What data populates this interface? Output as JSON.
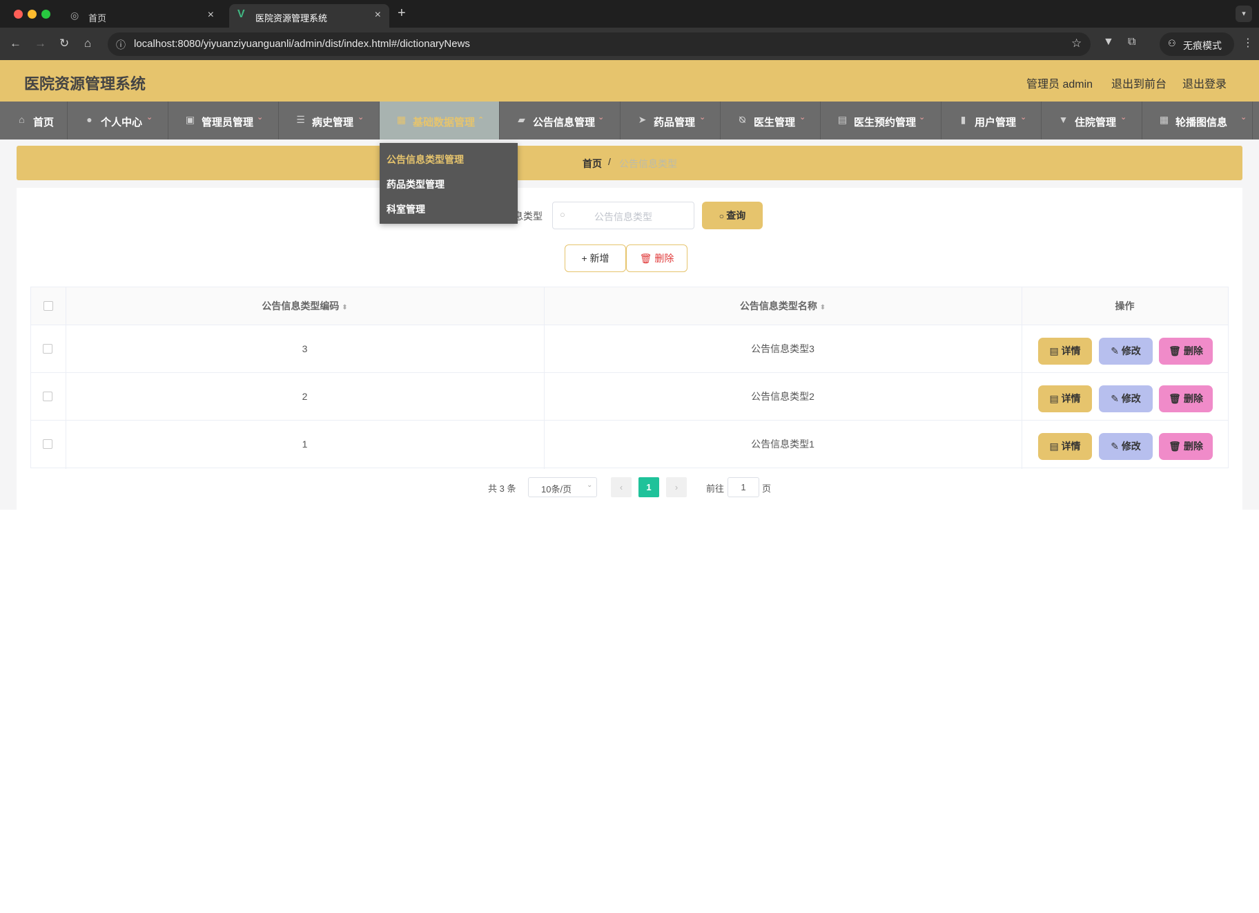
{
  "browser": {
    "tabs": [
      {
        "title": "首页"
      },
      {
        "title": "医院资源管理系统"
      }
    ],
    "url": "localhost:8080/yiyuanziyuanguanli/admin/dist/index.html#/dictionaryNews",
    "incognito_label": "无痕模式"
  },
  "header": {
    "title": "医院资源管理系统",
    "user": "管理员 admin",
    "back_frontend": "退出到前台",
    "logout": "退出登录"
  },
  "menu": [
    {
      "label": "首页",
      "icon": "home-icon"
    },
    {
      "label": "个人中心",
      "icon": "user-icon"
    },
    {
      "label": "管理员管理",
      "icon": "chart-icon"
    },
    {
      "label": "病史管理",
      "icon": "list-icon"
    },
    {
      "label": "基础数据管理",
      "icon": "grid-icon",
      "active": true
    },
    {
      "label": "公告信息管理",
      "icon": "ticket-icon"
    },
    {
      "label": "药品管理",
      "icon": "send-icon"
    },
    {
      "label": "医生管理",
      "icon": "bell-off-icon"
    },
    {
      "label": "医生预约管理",
      "icon": "briefcase-icon"
    },
    {
      "label": "用户管理",
      "icon": "clipboard-icon"
    },
    {
      "label": "住院管理",
      "icon": "brush-icon"
    },
    {
      "label": "轮播图信息",
      "icon": "grid-icon"
    }
  ],
  "dropdown": {
    "items": [
      "公告信息类型管理",
      "药品类型管理",
      "科室管理"
    ]
  },
  "breadcrumb": {
    "home": "首页",
    "separator": "/",
    "current": "公告信息类型"
  },
  "search": {
    "label_partial": "息类型",
    "placeholder": "公告信息类型",
    "query_button": "查询"
  },
  "actions": {
    "add": "新增",
    "delete": "删除"
  },
  "table": {
    "columns": [
      "公告信息类型编码",
      "公告信息类型名称",
      "操作"
    ],
    "rows": [
      {
        "code": "3",
        "name": "公告信息类型3"
      },
      {
        "code": "2",
        "name": "公告信息类型2"
      },
      {
        "code": "1",
        "name": "公告信息类型1"
      }
    ],
    "row_actions": {
      "detail": "详情",
      "edit": "修改",
      "delete": "删除"
    }
  },
  "pagination": {
    "total_text": "共 3 条",
    "page_size": "10条/页",
    "current_page": "1",
    "goto_label": "前往",
    "goto_value": "1",
    "page_suffix": "页"
  },
  "colors": {
    "accent": "#e6c46d",
    "menu_bg": "#6b6b6b",
    "detail_btn": "#e6c46d",
    "edit_btn": "#b7bfee",
    "delete_btn": "#f08bc9",
    "pager_active": "#1fc29a"
  }
}
